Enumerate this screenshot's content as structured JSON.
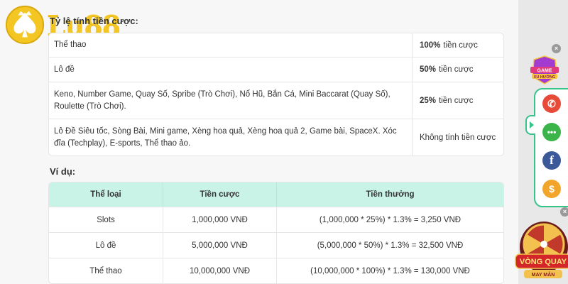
{
  "brand": {
    "logo_text": "Lu88",
    "gold": "#f3c623"
  },
  "rates_heading": "Tỷ lệ tính tiền cược:",
  "rates": [
    {
      "games": "Thể thao",
      "rate_value": "100%",
      "rate_suffix": "tiền cược"
    },
    {
      "games": "Lô đề",
      "rate_value": "50%",
      "rate_suffix": "tiền cược"
    },
    {
      "games": "Keno, Number Game, Quay Số, Spribe (Trò Chơi), Nổ Hũ, Bắn Cá, Mini Baccarat (Quay Số), Roulette (Trò Chơi).",
      "rate_value": "25%",
      "rate_suffix": "tiền cược"
    },
    {
      "games": "Lô Đề Siêu tốc, Sòng Bài, Mini game, Xèng hoa quả, Xèng hoa quả 2, Game bài, SpaceX. Xóc đĩa (Techplay), E-sports, Thể thao ảo.",
      "rate_value": "",
      "rate_suffix": "Không tính tiền cược"
    }
  ],
  "example_heading": "Ví dụ:",
  "example_table": {
    "headers": [
      "Thể loại",
      "Tiền cược",
      "Tiền thưởng"
    ],
    "rows": [
      [
        "Slots",
        "1,000,000 VNĐ",
        "(1,000,000 * 25%) * 1.3% = 3,250 VNĐ"
      ],
      [
        "Lô đề",
        "5,000,000 VNĐ",
        "(5,000,000 * 50%) * 1.3% = 32,500 VNĐ"
      ],
      [
        "Thể thao",
        "10,000,000 VNĐ",
        "(10,000,000 * 100%) * 1.3% = 130,000 VNĐ"
      ]
    ],
    "header_color": "#c9f3e6"
  },
  "widgets": {
    "game_badge_text_1": "GAME",
    "game_badge_text_2": "XU HƯỚNG",
    "close_glyph": "×",
    "wheel_text_1": "VÒNG QUAY",
    "wheel_text_2": "MAY MẮN",
    "contact_icons": [
      "phone-icon",
      "chat-icon",
      "facebook-icon",
      "coin-icon"
    ],
    "fb_glyph": "f",
    "phone_glyph": "✆",
    "chat_glyph": "•••",
    "coin_glyph": "$",
    "accent": "#35c58a"
  }
}
